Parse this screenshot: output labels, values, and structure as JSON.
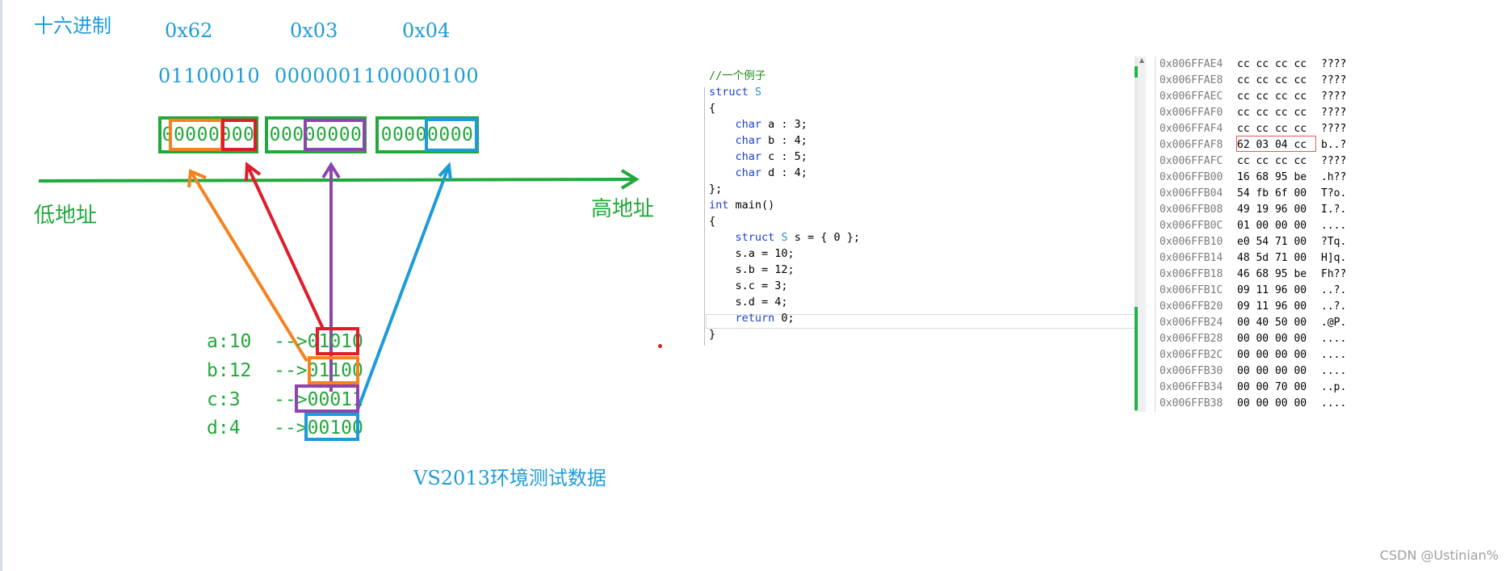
{
  "title": "十六进制",
  "hex_values": [
    "0x62",
    "0x03",
    "0x04"
  ],
  "binary_values": [
    "01100010",
    "00000011",
    "00000100"
  ],
  "byte_boxes": [
    "00000000",
    "00000000",
    "00000000"
  ],
  "low_address_label": "低地址",
  "high_address_label": "高地址",
  "fields": [
    {
      "name": "a:10",
      "arrow": "-->",
      "bits": "01010"
    },
    {
      "name": "b:12",
      "arrow": "-->",
      "bits": "01100"
    },
    {
      "name": "c:3",
      "arrow": "-->",
      "bits": "00011"
    },
    {
      "name": "d:4",
      "arrow": "-->",
      "bits": "00100"
    }
  ],
  "caption": "VS2013环境测试数据",
  "colors": {
    "green": "#21a83a",
    "cyan": "#1f9bd7",
    "orange": "#f58220",
    "red": "#e21b2b",
    "purple": "#8e44ad",
    "blue": "#1e9bd7"
  },
  "code": [
    {
      "t": "cm",
      "text": "//一个例子"
    },
    {
      "t": "mix",
      "parts": [
        [
          "kw",
          "struct"
        ],
        [
          "",
          " "
        ],
        [
          "ty",
          "S"
        ]
      ]
    },
    {
      "t": "",
      "text": "{"
    },
    {
      "t": "mix",
      "parts": [
        [
          "",
          "    "
        ],
        [
          "kw",
          "char"
        ],
        [
          "",
          " a : 3;"
        ]
      ]
    },
    {
      "t": "mix",
      "parts": [
        [
          "",
          "    "
        ],
        [
          "kw",
          "char"
        ],
        [
          "",
          " b : 4;"
        ]
      ]
    },
    {
      "t": "mix",
      "parts": [
        [
          "",
          "    "
        ],
        [
          "kw",
          "char"
        ],
        [
          "",
          " c : 5;"
        ]
      ]
    },
    {
      "t": "mix",
      "parts": [
        [
          "",
          "    "
        ],
        [
          "kw",
          "char"
        ],
        [
          "",
          " d : 4;"
        ]
      ]
    },
    {
      "t": "",
      "text": "};"
    },
    {
      "t": "mix",
      "parts": [
        [
          "kw",
          "int"
        ],
        [
          "",
          " main()"
        ]
      ]
    },
    {
      "t": "",
      "text": "{"
    },
    {
      "t": "mix",
      "parts": [
        [
          "",
          "    "
        ],
        [
          "kw",
          "struct"
        ],
        [
          "",
          " "
        ],
        [
          "ty",
          "S"
        ],
        [
          "",
          " s = { 0 };"
        ]
      ]
    },
    {
      "t": "",
      "text": "    s.a = 10;"
    },
    {
      "t": "",
      "text": "    s.b = 12;"
    },
    {
      "t": "",
      "text": "    s.c = 3;"
    },
    {
      "t": "",
      "text": "    s.d = 4;"
    },
    {
      "t": "mix",
      "parts": [
        [
          "",
          "    "
        ],
        [
          "kw",
          "return"
        ],
        [
          "",
          " 0;"
        ]
      ]
    },
    {
      "t": "",
      "text": "}"
    }
  ],
  "memory": [
    {
      "addr": "0x006FFAE4",
      "bytes": "cc cc cc cc",
      "ascii": "????"
    },
    {
      "addr": "0x006FFAE8",
      "bytes": "cc cc cc cc",
      "ascii": "????"
    },
    {
      "addr": "0x006FFAEC",
      "bytes": "cc cc cc cc",
      "ascii": "????"
    },
    {
      "addr": "0x006FFAF0",
      "bytes": "cc cc cc cc",
      "ascii": "????"
    },
    {
      "addr": "0x006FFAF4",
      "bytes": "cc cc cc cc",
      "ascii": "????"
    },
    {
      "addr": "0x006FFAF8",
      "bytes": "62 03 04 cc",
      "ascii": "b..?"
    },
    {
      "addr": "0x006FFAFC",
      "bytes": "cc cc cc cc",
      "ascii": "????"
    },
    {
      "addr": "0x006FFB00",
      "bytes": "16 68 95 be",
      "ascii": ".h??"
    },
    {
      "addr": "0x006FFB04",
      "bytes": "54 fb 6f 00",
      "ascii": "T?o."
    },
    {
      "addr": "0x006FFB08",
      "bytes": "49 19 96 00",
      "ascii": "I.?."
    },
    {
      "addr": "0x006FFB0C",
      "bytes": "01 00 00 00",
      "ascii": "...."
    },
    {
      "addr": "0x006FFB10",
      "bytes": "e0 54 71 00",
      "ascii": "?Tq."
    },
    {
      "addr": "0x006FFB14",
      "bytes": "48 5d 71 00",
      "ascii": "H]q."
    },
    {
      "addr": "0x006FFB18",
      "bytes": "46 68 95 be",
      "ascii": "Fh??"
    },
    {
      "addr": "0x006FFB1C",
      "bytes": "09 11 96 00",
      "ascii": "..?."
    },
    {
      "addr": "0x006FFB20",
      "bytes": "09 11 96 00",
      "ascii": "..?."
    },
    {
      "addr": "0x006FFB24",
      "bytes": "00 40 50 00",
      "ascii": ".@P."
    },
    {
      "addr": "0x006FFB28",
      "bytes": "00 00 00 00",
      "ascii": "...."
    },
    {
      "addr": "0x006FFB2C",
      "bytes": "00 00 00 00",
      "ascii": "...."
    },
    {
      "addr": "0x006FFB30",
      "bytes": "00 00 00 00",
      "ascii": "...."
    },
    {
      "addr": "0x006FFB34",
      "bytes": "00 00 70 00",
      "ascii": "..p."
    },
    {
      "addr": "0x006FFB38",
      "bytes": "00 00 00 00",
      "ascii": "...."
    }
  ],
  "watermark": "CSDN @Ustinian%"
}
